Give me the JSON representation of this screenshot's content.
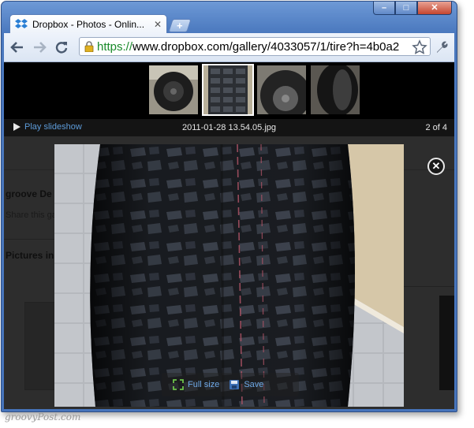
{
  "browser": {
    "tab_title": "Dropbox - Photos - Onlin...",
    "url_scheme": "https://",
    "url_rest": "www.dropbox.com/gallery/4033057/1/tire?h=4b0a2"
  },
  "gallery": {
    "play_label": "Play slideshow",
    "filename": "2011-01-28 13.54.05.jpg",
    "counter": "2 of 4",
    "full_size_label": "Full size",
    "save_label": "Save"
  },
  "background_page": {
    "title_fragment": "groove De",
    "share_fragment": "Share this ga",
    "pictures_fragment": "Pictures in"
  },
  "watermark": "groovyPost.com",
  "colors": {
    "accent_link": "#5d9bd9",
    "window_frame": "#4674bb",
    "secure_green": "#1a8a2a"
  }
}
